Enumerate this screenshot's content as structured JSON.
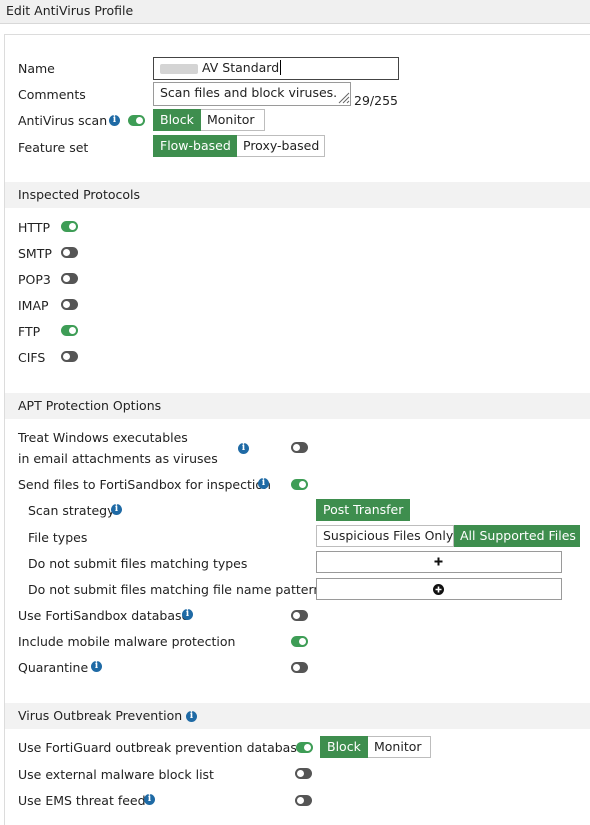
{
  "header": {
    "title": "Edit AntiVirus Profile"
  },
  "general": {
    "name_label": "Name",
    "name_value": "AV Standard",
    "comments_label": "Comments",
    "comments_value": "Scan files and block viruses.",
    "comments_count": "29/255",
    "av_scan_label": "AntiVirus scan",
    "av_scan_options": [
      "Block",
      "Monitor"
    ],
    "feature_set_label": "Feature set",
    "feature_set_options": [
      "Flow-based",
      "Proxy-based"
    ]
  },
  "protocols": {
    "title": "Inspected Protocols",
    "items": [
      {
        "label": "HTTP",
        "on": true
      },
      {
        "label": "SMTP",
        "on": false
      },
      {
        "label": "POP3",
        "on": false
      },
      {
        "label": "IMAP",
        "on": false
      },
      {
        "label": "FTP",
        "on": true
      },
      {
        "label": "CIFS",
        "on": false
      }
    ]
  },
  "apt": {
    "title": "APT Protection Options",
    "treat_windows_line1": "Treat Windows executables",
    "treat_windows_line2": "in email attachments as viruses",
    "send_files_label": "Send files to FortiSandbox for inspection",
    "scan_strategy_label": "Scan strategy",
    "scan_strategy_value": "Post Transfer",
    "file_types_label": "File types",
    "file_types_options": [
      "Suspicious Files Only",
      "All Supported Files"
    ],
    "no_submit_types_label": "Do not submit files matching types",
    "no_submit_patterns_label": "Do not submit files matching file name patterns",
    "sandbox_db_label": "Use FortiSandbox database",
    "mobile_label": "Include mobile malware protection",
    "quarantine_label": "Quarantine"
  },
  "outbreak": {
    "title": "Virus Outbreak Prevention",
    "fortiguard_label": "Use FortiGuard outbreak prevention database",
    "fortiguard_options": [
      "Block",
      "Monitor"
    ],
    "external_label": "Use external malware block list",
    "ems_label": "Use EMS threat feed"
  },
  "colors": {
    "accent_green": "#3e8e4e",
    "toggle_off": "#555555",
    "info_blue": "#1f6aa5"
  }
}
